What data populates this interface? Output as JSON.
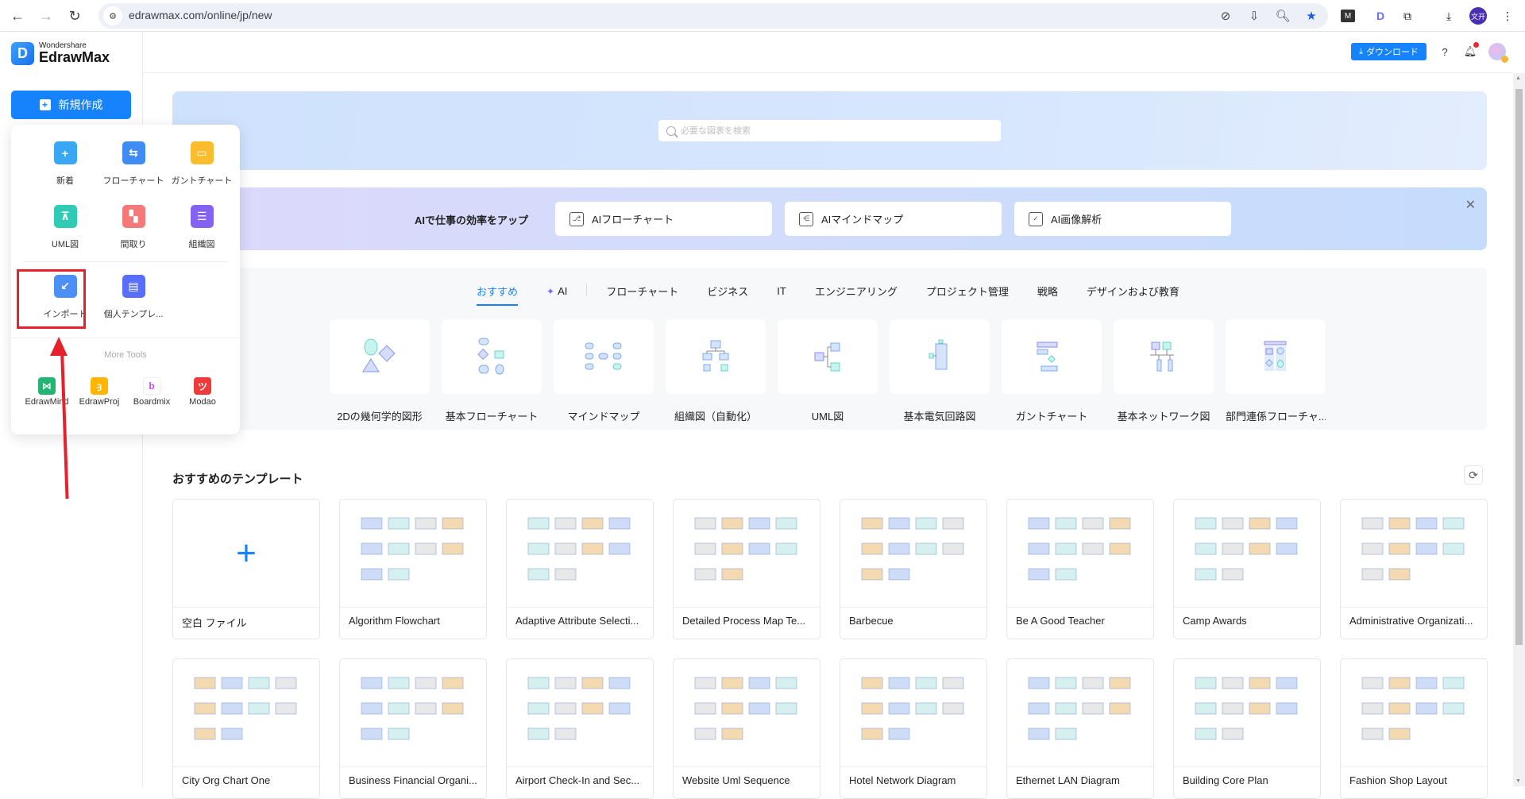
{
  "browser": {
    "url": "edrawmax.com/online/jp/new",
    "profile_initials": "文开"
  },
  "app": {
    "brand_small": "Wondershare",
    "brand_big": "EdrawMax",
    "new_button": "新規作成",
    "download_button": "ダウンロード"
  },
  "popup": {
    "items": [
      {
        "label": "新着",
        "icon": "plus-icon",
        "color": "#3aa7f5"
      },
      {
        "label": "フローチャート",
        "icon": "flowchart-icon",
        "color": "#3f8cf5"
      },
      {
        "label": "ガントチャート",
        "icon": "gantt-icon",
        "color": "#fbbd2e"
      },
      {
        "label": "UML図",
        "icon": "uml-icon",
        "color": "#2fcbb5"
      },
      {
        "label": "間取り",
        "icon": "floorplan-icon",
        "color": "#f47a7a"
      },
      {
        "label": "組織図",
        "icon": "orgchart-icon",
        "color": "#8462f2"
      },
      {
        "label": "インポート",
        "icon": "import-icon",
        "color": "#4b8ff7"
      },
      {
        "label": "個人テンプレ...",
        "icon": "template-icon",
        "color": "#5a6ff7"
      }
    ],
    "more_tools_label": "More Tools",
    "tools": [
      {
        "label": "EdrawMind",
        "color": "#22b573"
      },
      {
        "label": "EdrawProj",
        "color": "#ffb400"
      },
      {
        "label": "Boardmix",
        "color": "#ffffff"
      },
      {
        "label": "Modao",
        "color": "#f03a3a"
      }
    ]
  },
  "search": {
    "placeholder": "必要な図表を検索"
  },
  "ai_banner": {
    "title": "AIで仕事の効率をアップ",
    "cards": [
      {
        "label": "AIフローチャート"
      },
      {
        "label": "AIマインドマップ"
      },
      {
        "label": "AI画像解析"
      }
    ]
  },
  "categories": {
    "tabs": [
      "おすすめ",
      "AI",
      "フローチャート",
      "ビジネス",
      "IT",
      "エンジニアリング",
      "プロジェクト管理",
      "戦略",
      "デザインおよび教育"
    ],
    "active_tab": "おすすめ",
    "cards": [
      "2Dの幾何学的図形",
      "基本フローチャート",
      "マインドマップ",
      "組織図（自動化）",
      "UML図",
      "基本電気回路図",
      "ガントチャート",
      "基本ネットワーク図",
      "部門連係フローチャ..."
    ]
  },
  "templates": {
    "title": "おすすめのテンプレート",
    "items": [
      "空白 ファイル",
      "Algorithm Flowchart",
      "Adaptive Attribute Selecti...",
      "Detailed Process Map Te...",
      "Barbecue",
      "Be A Good Teacher",
      "Camp Awards",
      "Administrative Organizati...",
      "City Org Chart One",
      "Business Financial Organi...",
      "Airport Check-In and Sec...",
      "Website Uml Sequence",
      "Hotel Network Diagram",
      "Ethernet LAN Diagram",
      "Building Core Plan",
      "Fashion Shop Layout"
    ]
  },
  "colors": {
    "accent": "#1683fc",
    "annotation_red": "#e5222c"
  }
}
